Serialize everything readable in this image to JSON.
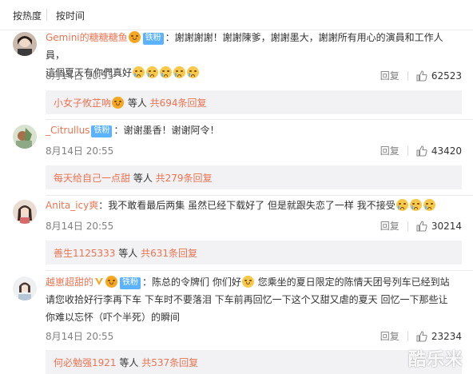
{
  "sort": {
    "hot": "按热度",
    "time": "按时间"
  },
  "badge_label": "铁粉",
  "comments": [
    {
      "user": "Gemini的糖糖糖鱼",
      "line1": "：謝謝謝謝！謝謝陳爹，謝謝墨大，謝謝所有用心的演員和工作人員，",
      "line2": "這個夏天有你們真好",
      "time": "8月14日 20:55",
      "reply": "回复",
      "likes": "62523",
      "sub_user": "小女子攸芷吶",
      "sub_mid": " 等人 ",
      "sub_count": "共694条回复"
    },
    {
      "user": "_Citrullus",
      "line1": "：谢谢墨香！谢谢阿令！",
      "time": "8月14日 20:55",
      "reply": "回复",
      "likes": "43420",
      "sub_user": "每天给自己一点甜",
      "sub_mid": " 等人 ",
      "sub_count": "共279条回复"
    },
    {
      "user": "Anita_icy爽",
      "line1": "：我不敢看最后两集 虽然已经下载好了 但是就跟失恋了一样 我不接受",
      "time": "8月14日 20:55",
      "reply": "回复",
      "likes": "30214",
      "sub_user": "善生1125333",
      "sub_mid": " 等人 ",
      "sub_count": "共631条回复"
    },
    {
      "user": "越崽超甜的",
      "line1": "：陈总的令牌们 你们好",
      "line1b": " 您乘坐的夏日限定的陈情天团号列车已经到站",
      "line2": "请您收拾好行李再下车 下车时不要落泪   下车前再回忆一下这个又甜又虐的夏天  回忆一下那些让",
      "line3": "你难以忘怀（吓个半死）的瞬间",
      "time": "8月14日 20:55",
      "reply": "回复",
      "likes": "23234",
      "sub_user": "何必勉强1921",
      "sub_mid": " 等人 ",
      "sub_count": "共537条回复"
    }
  ],
  "watermark": "酷乐米",
  "colors": {
    "username": "#eb7350",
    "badge": "#5bb2fe",
    "meta": "#808080",
    "subreply_bg": "#f2f2f5"
  }
}
